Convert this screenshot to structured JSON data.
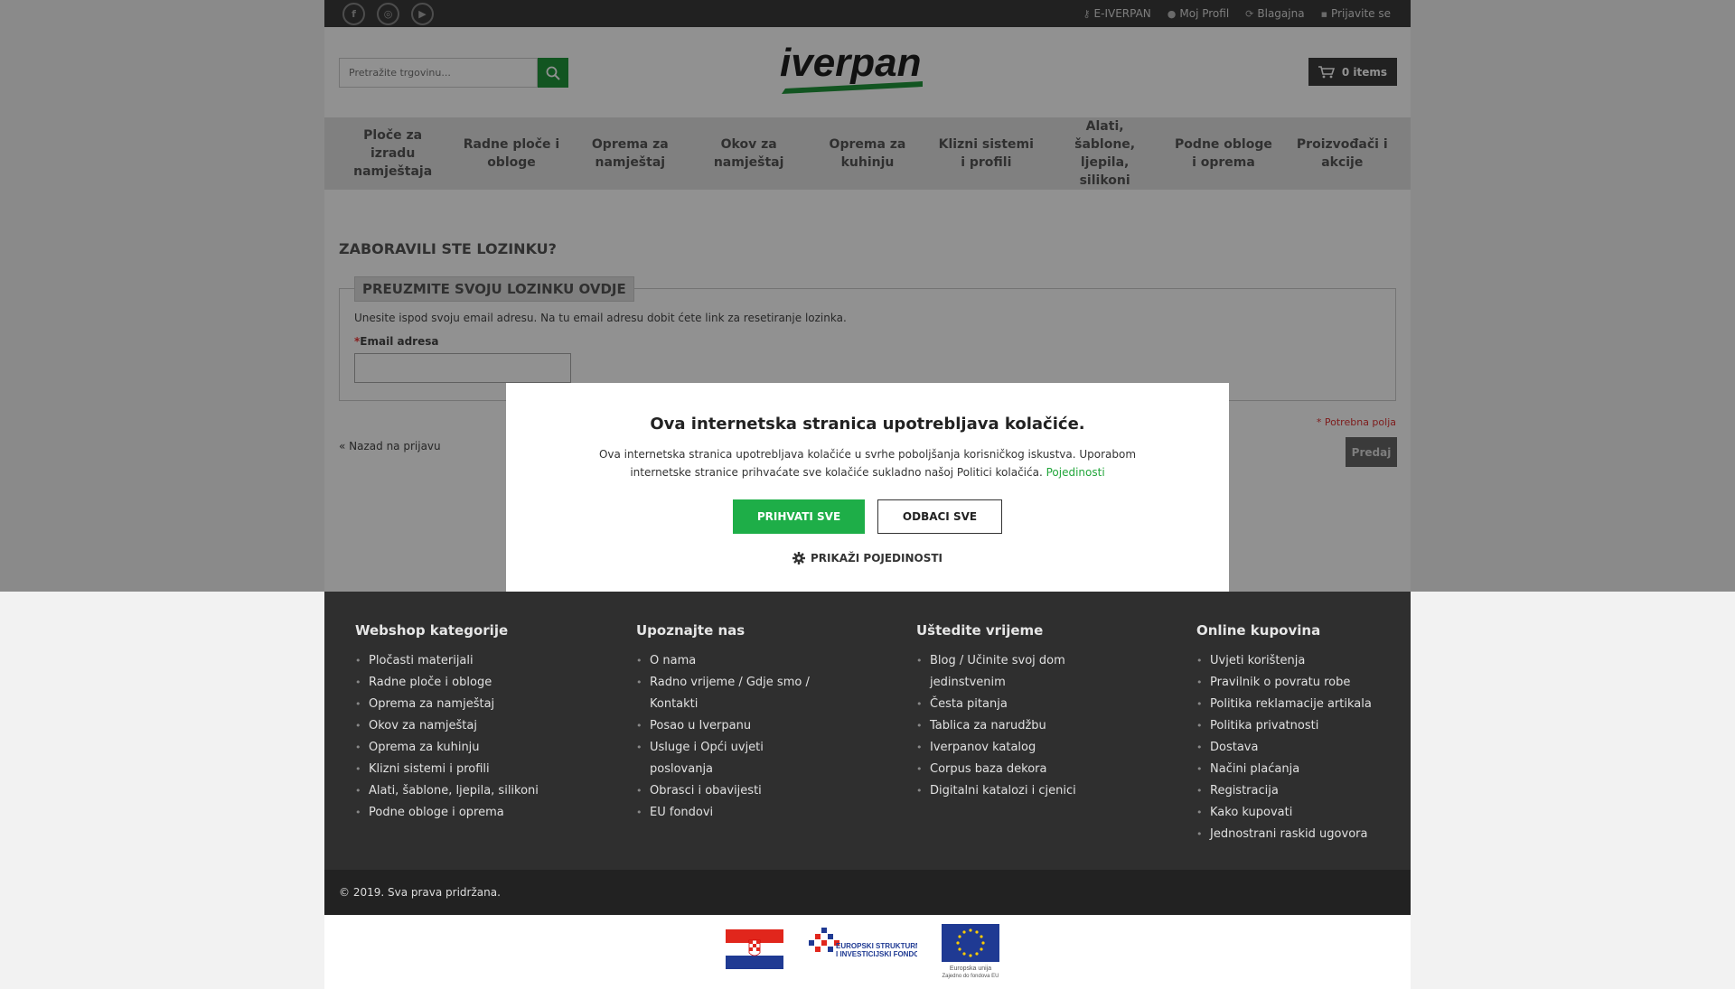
{
  "topbar": {
    "social": [
      {
        "icon": "facebook-icon",
        "glyph": "f"
      },
      {
        "icon": "instagram-icon",
        "glyph": "◎"
      },
      {
        "icon": "youtube-icon",
        "glyph": "▶"
      }
    ],
    "links": [
      {
        "label": "E-IVERPAN",
        "icon": "key-icon",
        "glyph": "⚷"
      },
      {
        "label": "Moj Profil",
        "icon": "user-icon",
        "glyph": "👤"
      },
      {
        "label": "Blagajna",
        "icon": "checkout-icon",
        "glyph": "⟳"
      },
      {
        "label": "Prijavite se",
        "icon": "lock-icon",
        "glyph": "🔒"
      }
    ]
  },
  "header": {
    "search_placeholder": "Pretražite trgovinu...",
    "logo_text": "iverpan",
    "cart_label": "0 items"
  },
  "nav": [
    "Ploče za izradu namještaja",
    "Radne ploče i obloge",
    "Oprema za namještaj",
    "Okov za namještaj",
    "Oprema za kuhinju",
    "Klizni sistemi i profili",
    "Alati, šablone, ljepila, silikoni",
    "Podne obloge i oprema",
    "Proizvođači i akcije"
  ],
  "page": {
    "title": "ZABORAVILI STE LOZINKU?",
    "legend": "PREUZMITE SVOJU LOZINKU OVDJE",
    "hint": "Unesite ispod svoju email adresu. Na tu email adresu dobit ćete link za resetiranje lozinka.",
    "email_required_mark": "*",
    "email_label": "Email adresa",
    "required_note": "* Potrebna polja",
    "back_link": "« Nazad na prijavu",
    "submit_label": "Predaj"
  },
  "footer": {
    "columns": [
      {
        "title": "Webshop kategorije",
        "items": [
          "Pločasti materijali",
          "Radne ploče i obloge",
          "Oprema za namještaj",
          "Okov za namještaj",
          "Oprema za kuhinju",
          "Klizni sistemi i profili",
          "Alati, šablone, ljepila, silikoni",
          "Podne obloge i oprema"
        ]
      },
      {
        "title": "Upoznajte nas",
        "items": [
          "O nama",
          "Radno vrijeme / Gdje smo / Kontakti",
          "Posao u Iverpanu",
          "Usluge i Opći uvjeti poslovanja",
          "Obrasci i obavijesti",
          "EU fondovi"
        ]
      },
      {
        "title": "Uštedite vrijeme",
        "items": [
          "Blog / Učinite svoj dom jedinstvenim",
          "Česta pitanja",
          "Tablica za narudžbu",
          "Iverpanov katalog",
          "Corpus baza dekora",
          "Digitalni katalozi i cjenici"
        ]
      },
      {
        "title": "Online kupovina",
        "items": [
          "Uvjeti korištenja",
          "Pravilnik o povratu robe",
          "Politika reklamacije artikala",
          "Politika privatnosti",
          "Dostava",
          "Načini plaćanja",
          "Registracija",
          "Kako kupovati",
          "Jednostrani raskid ugovora"
        ]
      }
    ],
    "copyright": "© 2019. Sva prava pridržana.",
    "esif_text_1": "EUROPSKI STRUKTURNI",
    "esif_text_2": "I INVESTICIJSKI FONDOVI",
    "eu_text_1": "Europska unija",
    "eu_text_2": "Zajedno do fondova EU"
  },
  "cookie": {
    "title": "Ova internetska stranica upotrebljava kolačiće.",
    "text": "Ova internetska stranica upotrebljava kolačiće u svrhe poboljšanja korisničkog iskustva. Uporabom internetske stranice prihvaćate sve kolačiće sukladno našoj Politici kolačića.",
    "details_link": "Pojedinosti",
    "accept": "PRIHVATI SVE",
    "reject": "ODBACI SVE",
    "show_details": "PRIKAŽI POJEDINOSTI"
  },
  "colors": {
    "brand_green": "#21963b",
    "accent_green": "#1eae48",
    "dark": "#2f2f2f"
  }
}
